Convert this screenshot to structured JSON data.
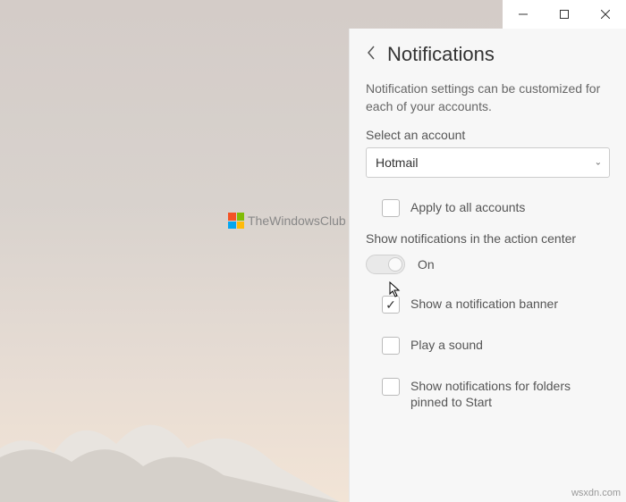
{
  "watermark": "TheWindowsClub",
  "attribution": "wsxdn.com",
  "panel": {
    "title": "Notifications",
    "description": "Notification settings can be customized for each of your accounts.",
    "select_label": "Select an account",
    "selected_account": "Hotmail",
    "apply_all": "Apply to all accounts",
    "section_action_center": "Show notifications in the action center",
    "toggle_state": "On",
    "opt_banner": "Show a notification banner",
    "opt_sound": "Play a sound",
    "opt_folders": "Show notifications for folders pinned to Start"
  }
}
